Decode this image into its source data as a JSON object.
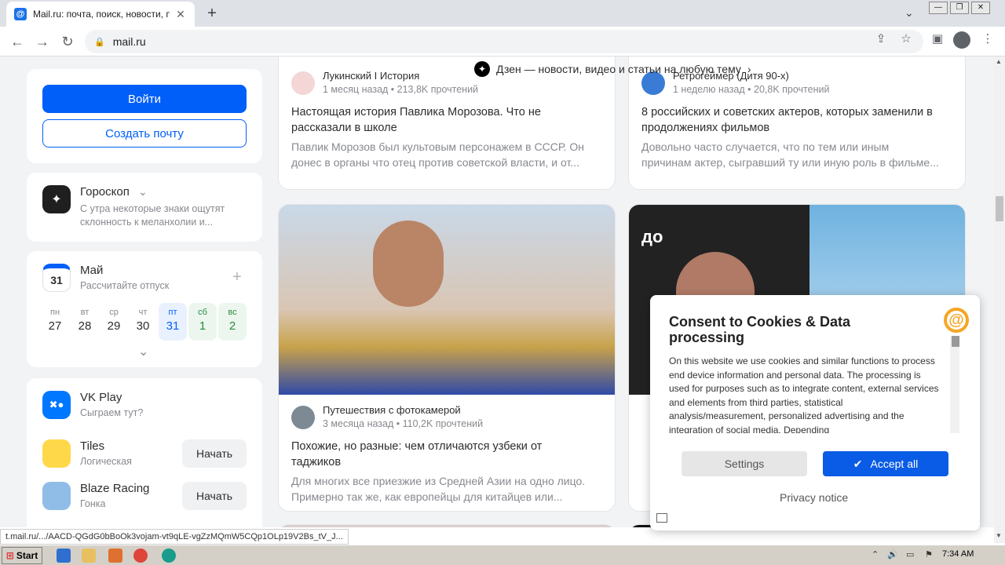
{
  "browser": {
    "tab_title": "Mail.ru: почта, поиск, новости, пр",
    "tab_close": "✕",
    "new_tab": "+",
    "tab_menu": "⌄",
    "url": "mail.ru",
    "back": "←",
    "forward": "→",
    "reload": "↻"
  },
  "auth": {
    "login_label": "Войти",
    "create_label": "Создать почту"
  },
  "horoscope": {
    "title": "Гороскоп",
    "text_line1": "С утра некоторые знаки ощутят",
    "text_line2": "склонность к меланхолии и..."
  },
  "calendar": {
    "day": "31",
    "month": "Май",
    "subtitle": "Рассчитайте отпуск",
    "plus": "+",
    "days": [
      {
        "name": "пн",
        "num": "27"
      },
      {
        "name": "вт",
        "num": "28"
      },
      {
        "name": "ср",
        "num": "29"
      },
      {
        "name": "чт",
        "num": "30"
      },
      {
        "name": "пт",
        "num": "31"
      },
      {
        "name": "сб",
        "num": "1"
      },
      {
        "name": "вс",
        "num": "2"
      }
    ]
  },
  "vkplay": {
    "title": "VK Play",
    "subtitle": "Сыграем тут?",
    "games": [
      {
        "name": "Tiles",
        "genre": "Логическая",
        "action": "Начать"
      },
      {
        "name": "Blaze Racing",
        "genre": "Гонка",
        "action": "Начать"
      }
    ]
  },
  "dzen_banner": "Дзен — новости, видео и статьи на любую тему",
  "feed": [
    {
      "source": "Лукинский I История",
      "meta": "1 месяц назад • 213,8K прочтений",
      "title_l1": "Настоящая история Павлика Морозова. Что не",
      "title_l2": "рассказали в школе",
      "desc_l1": "Павлик Морозов был культовым персонажем в СССР. Он",
      "desc_l2": "донес в органы что отец против советской власти, и от..."
    },
    {
      "source": "Ретрогеймер (Дитя 90-х)",
      "meta": "1 неделю назад • 20,8K прочтений",
      "title_l1": "8 российских и советских актеров, которых заменили в",
      "title_l2": "продолжениях фильмов",
      "desc_l1": "Довольно часто случается, что по тем или иным",
      "desc_l2": "причинам актер, сыгравший ту или иную роль в фильме..."
    },
    {
      "source": "Путешествия с фотокамерой",
      "meta": "3 месяца назад • 110,2K прочтений",
      "title_l1": "Похожие, но разные: чем отличаются узбеки от",
      "title_l2": "таджиков",
      "desc_l1": "Для многих все приезжие из Средней Азии на одно лицо.",
      "desc_l2": "Примерно так же, как европейцы для китайцев или..."
    }
  ],
  "image_label_do": "до",
  "consent": {
    "title": "Consent to Cookies & Data processing",
    "body": "On this website we use cookies and similar functions to process end device information and personal data. The processing is used for purposes such as to integrate content, external services and elements from third parties, statistical analysis/measurement, personalized advertising and the integration of social media. Depending",
    "settings": "Settings",
    "accept": "Accept all",
    "privacy": "Privacy notice"
  },
  "status_url": "t.mail.ru/.../AACD-QGdG0bBoOk3vojam-vt9qLE-vgZzMQmW5CQp1OLp19V2Bs_tV_J...",
  "taskbar": {
    "start": "Start",
    "clock": "7:34 AM"
  },
  "colors": {
    "brand_blue": "#005ff9",
    "accept_blue": "#0a5ce6",
    "at_orange": "#f5a623"
  }
}
